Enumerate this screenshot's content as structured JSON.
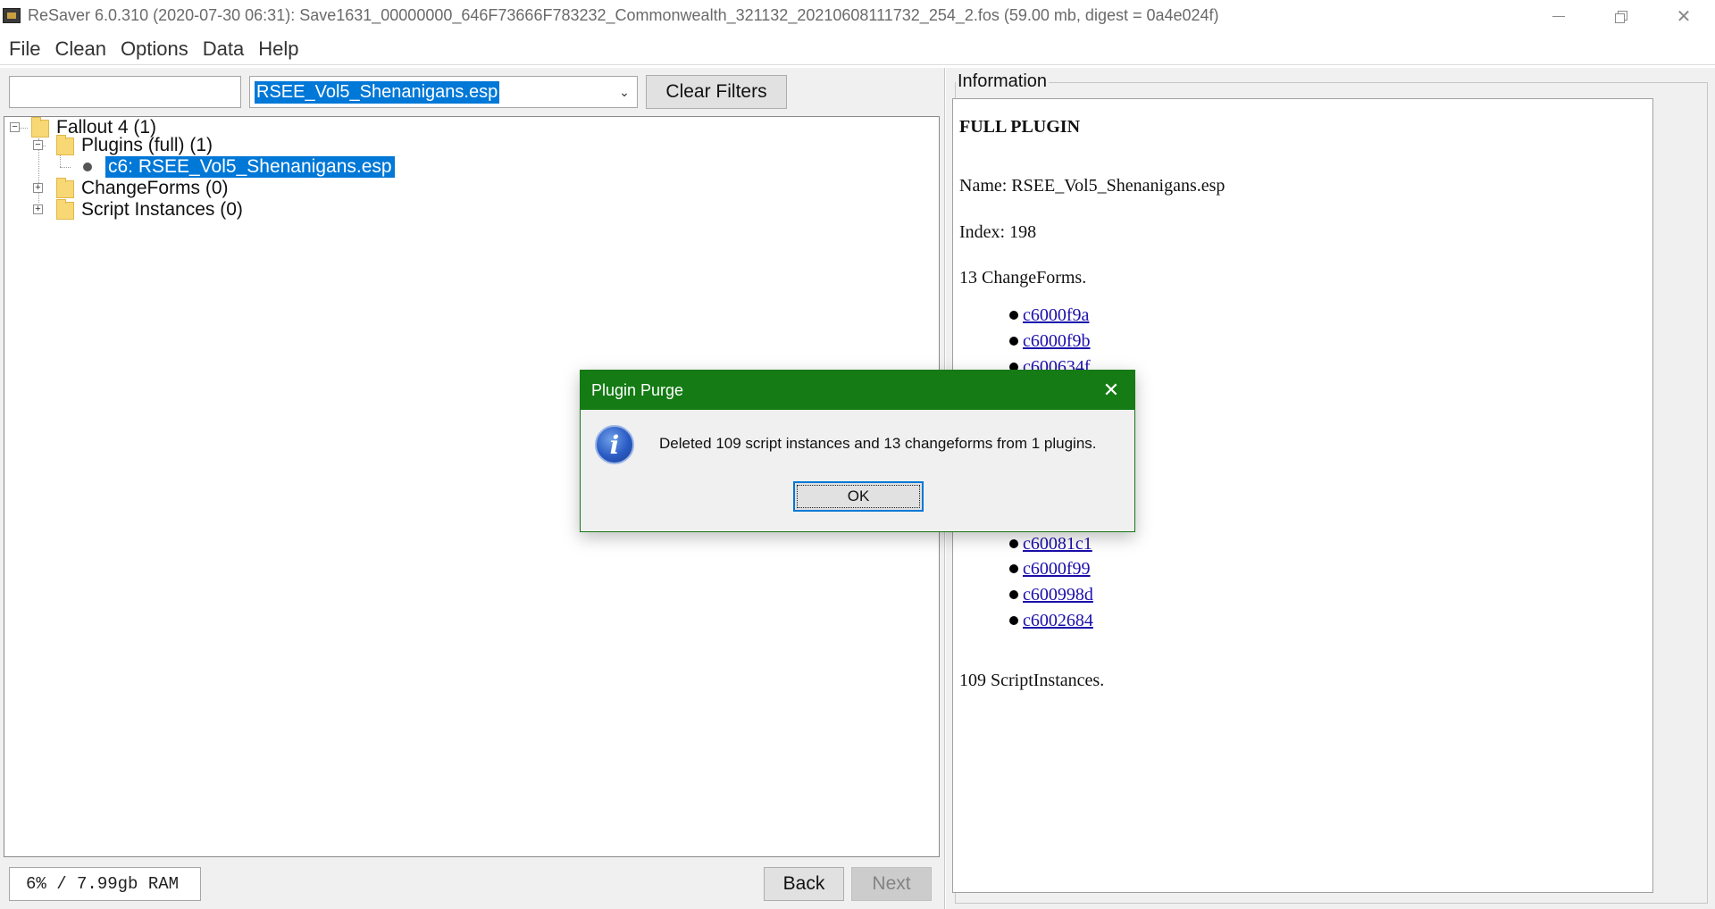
{
  "window": {
    "title": "ReSaver 6.0.310 (2020-07-30 06:31): Save1631_00000000_646F73666F783232_Commonwealth_321132_20210608111732_254_2.fos (59.00 mb, digest = 0a4e024f)",
    "icon": "resaver-app-icon",
    "controls": {
      "minimize": "minimize-icon",
      "restore": "restore-icon",
      "close": "close-icon"
    }
  },
  "menu": {
    "items": [
      "File",
      "Clean",
      "Options",
      "Data",
      "Help"
    ]
  },
  "filter": {
    "text_value": "",
    "plugin_selected": "RSEE_Vol5_Shenanigans.esp",
    "clear_label": "Clear Filters"
  },
  "tree": {
    "root": "Fallout 4 (1)",
    "plugins": "Plugins (full) (1)",
    "plugin_item": "c6: RSEE_Vol5_Shenanigans.esp",
    "changeforms": "ChangeForms (0)",
    "scripts": "Script Instances (0)",
    "expander_collapse": "−",
    "expander_expand": "+"
  },
  "status": {
    "ram": "6% / 7.99gb RAM"
  },
  "nav": {
    "back_label": "Back",
    "next_label": "Next"
  },
  "info": {
    "legend": "Information",
    "heading": "FULL PLUGIN",
    "name_line": "Name: RSEE_Vol5_Shenanigans.esp",
    "index_line": "Index: 198",
    "changeforms_line": "13 ChangeForms.",
    "changeform_links_visible_top": [
      "c6000f9a",
      "c6000f9b",
      "c600634f"
    ],
    "changeform_links_visible_bottom": [
      "c60081c1",
      "c6000f99",
      "c600998d",
      "c6002684"
    ],
    "scripts_line": "109 ScriptInstances."
  },
  "dialog": {
    "title": "Plugin Purge",
    "message": "Deleted 109 script instances and 13 changeforms from 1 plugins.",
    "ok_label": "OK",
    "icon": "info-icon",
    "close_glyph": "✕"
  },
  "colors": {
    "dialog_title_bg": "#157b15",
    "selection": "#0078d7",
    "link": "#1a0dab"
  }
}
